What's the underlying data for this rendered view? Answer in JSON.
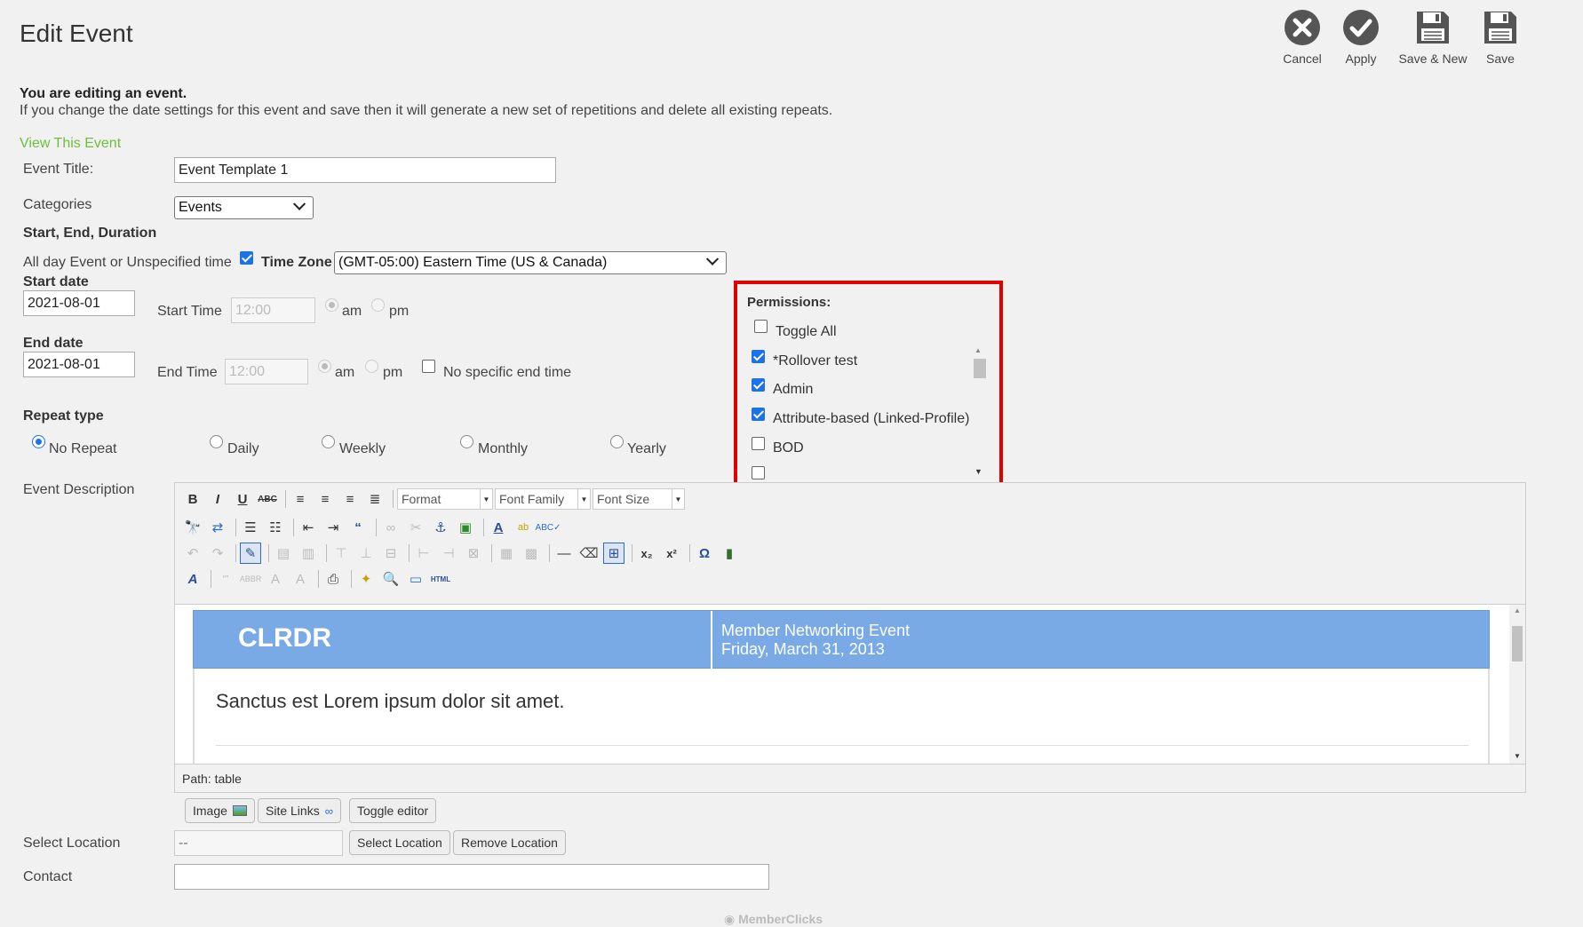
{
  "page": {
    "title": "Edit Event"
  },
  "toolbar": {
    "cancel": "Cancel",
    "apply": "Apply",
    "save_new": "Save & New",
    "save": "Save"
  },
  "notice": {
    "title": "You are editing an event.",
    "body": "If you change the date settings for this event and save then it will generate a new set of repetitions and delete all existing repeats."
  },
  "view_link": "View This Event",
  "form": {
    "event_title_label": "Event Title:",
    "event_title_value": "Event Template 1",
    "categories_label": "Categories",
    "categories_value": "Events",
    "section_start_end": "Start, End, Duration",
    "all_day_label": "All day Event or Unspecified time",
    "all_day_checked": true,
    "timezone_label": "Time Zone",
    "timezone_value": "(GMT-05:00) Eastern Time (US & Canada)",
    "start_date_label": "Start date",
    "start_date_value": "2021-08-01",
    "start_time_label": "Start Time",
    "start_time_value": "12:00",
    "end_date_label": "End date",
    "end_date_value": "2021-08-01",
    "end_time_label": "End Time",
    "end_time_value": "12:00",
    "am": "am",
    "pm": "pm",
    "no_end_time_label": "No specific end time",
    "repeat_type_label": "Repeat type",
    "repeat_options": [
      "No Repeat",
      "Daily",
      "Weekly",
      "Monthly",
      "Yearly"
    ],
    "repeat_selected": "No Repeat",
    "description_label": "Event Description",
    "select_location_label": "Select Location",
    "location_placeholder": "--",
    "select_location_button": "Select Location",
    "remove_location_button": "Remove Location",
    "contact_label": "Contact",
    "contact_value": ""
  },
  "permissions": {
    "title": "Permissions:",
    "toggle_all": "Toggle All",
    "items": [
      {
        "label": "*Rollover test",
        "checked": true
      },
      {
        "label": "Admin",
        "checked": true
      },
      {
        "label": "Attribute-based (Linked-Profile)",
        "checked": true
      },
      {
        "label": "BOD",
        "checked": false
      }
    ]
  },
  "editor": {
    "format": "Format",
    "font_family": "Font Family",
    "font_size": "Font Size",
    "email_brand": "CLRDR",
    "email_event_name": "Member Networking Event",
    "email_event_date": "Friday, March 31, 2013",
    "email_body_text": "Sanctus est Lorem ipsum dolor sit amet.",
    "path_label": "Path:",
    "path_value": "table"
  },
  "editor_buttons": {
    "image": "Image",
    "site_links": "Site Links",
    "toggle_editor": "Toggle editor"
  },
  "footer": {
    "brand": "MemberClicks"
  },
  "colors": {
    "accent_green": "#6cbf3c",
    "highlight_red": "#e00000",
    "email_header": "#7aaae6",
    "checkbox_blue": "#1a73e8"
  }
}
